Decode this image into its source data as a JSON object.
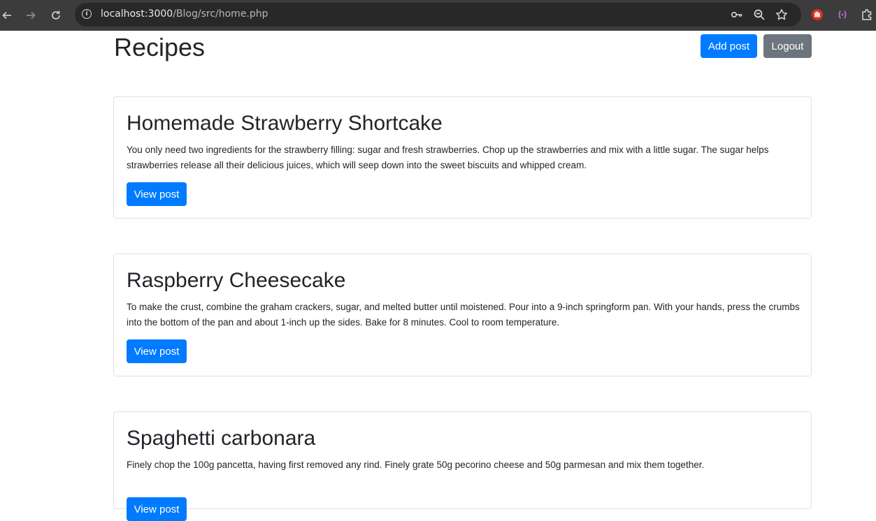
{
  "browser": {
    "url_host": "localhost:3000",
    "url_path": "/Blog/src/home.php",
    "icons": {
      "back": "back-arrow-icon",
      "forward": "forward-arrow-icon",
      "reload": "reload-icon",
      "site_info": "info-icon",
      "password": "key-icon",
      "zoom": "zoom-icon",
      "bookmark": "star-icon",
      "extension_1": "hand-stop-icon",
      "extension_2": "brackets-icon",
      "extensions": "puzzle-icon"
    }
  },
  "header": {
    "title": "Recipes",
    "add_post_label": "Add post",
    "logout_label": "Logout"
  },
  "colors": {
    "primary": "#007bff",
    "secondary": "#6c757d",
    "text": "#212529",
    "card_border": "#dee2e6"
  },
  "posts": [
    {
      "title": "Homemade Strawberry Shortcake",
      "excerpt": "You only need two ingredients for the strawberry filling: sugar and fresh strawberries. Chop up the strawberries and mix with a little sugar. The sugar helps strawberries release all their delicious juices, which will seep down into the sweet biscuits and whipped cream.",
      "button_label": "View post"
    },
    {
      "title": "Raspberry Cheesecake",
      "excerpt": "To make the crust, combine the graham crackers, sugar, and melted butter until moistened. Pour into a 9-inch springform pan. With your hands, press the crumbs into the bottom of the pan and about 1-inch up the sides. Bake for 8 minutes. Cool to room temperature.",
      "button_label": "View post"
    },
    {
      "title": "Spaghetti carbonara",
      "excerpt": "Finely chop the 100g pancetta, having first removed any rind. Finely grate 50g pecorino cheese and 50g parmesan and mix them together.",
      "button_label": "View post"
    }
  ]
}
